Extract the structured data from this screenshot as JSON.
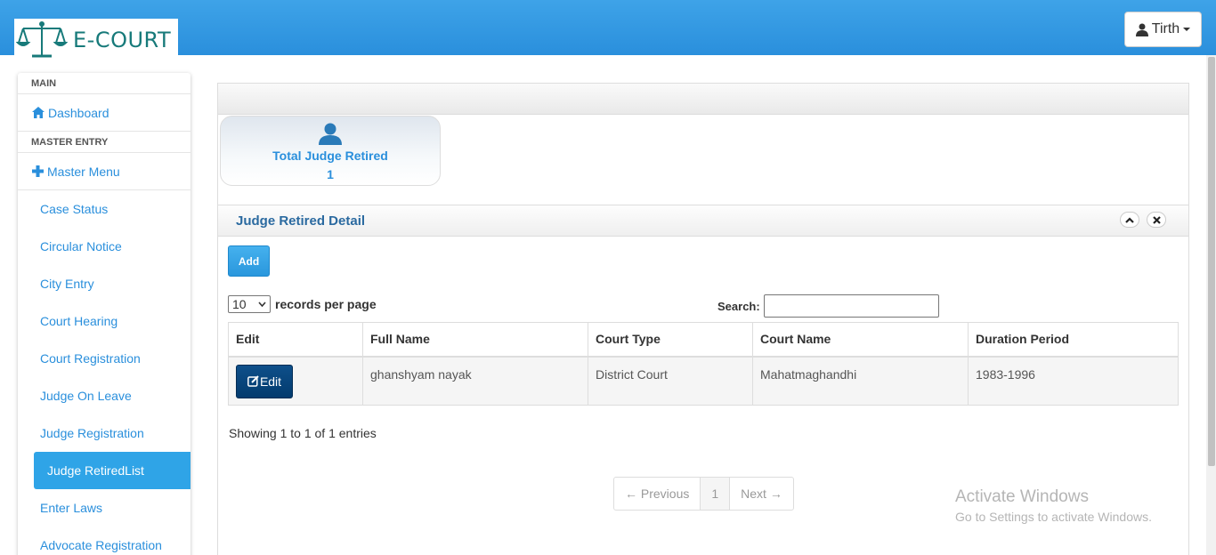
{
  "header": {
    "logo_text": "E-COURT",
    "user_name": "Tirth"
  },
  "sidebar": {
    "section_main": "MAIN",
    "dashboard": "Dashboard",
    "section_master": "MASTER ENTRY",
    "master_menu": "Master Menu",
    "items": [
      {
        "label": "Case Status",
        "active": false
      },
      {
        "label": "Circular Notice",
        "active": false
      },
      {
        "label": "City Entry",
        "active": false
      },
      {
        "label": "Court Hearing",
        "active": false
      },
      {
        "label": "Court Registration",
        "active": false
      },
      {
        "label": "Judge On Leave",
        "active": false
      },
      {
        "label": "Judge Registration",
        "active": false
      },
      {
        "label": "Judge RetiredList",
        "active": true
      },
      {
        "label": "Enter Laws",
        "active": false
      },
      {
        "label": "Advocate Registration",
        "active": false
      }
    ]
  },
  "stat": {
    "title": "Total Judge Retired",
    "value": "1"
  },
  "panel": {
    "title": "Judge Retired Detail",
    "add_label": "Add",
    "length_value": "10",
    "length_label": "records per page",
    "search_label": "Search:",
    "search_value": "",
    "columns": [
      "Edit",
      "Full Name",
      "Court Type",
      "Court Name",
      "Duration Period"
    ],
    "rows": [
      {
        "edit_label": "Edit",
        "full_name": "ghanshyam nayak",
        "court_type": "District Court",
        "court_name": "Mahatmaghandhi",
        "duration": "1983-1996"
      }
    ],
    "info": "Showing 1 to 1 of 1 entries",
    "pager": {
      "previous": "← Previous",
      "page": "1",
      "next": "Next →"
    }
  },
  "watermark": {
    "line1": "Activate Windows",
    "line2": "Go to Settings to activate Windows."
  },
  "colors": {
    "header_blue": "#2a8fdc",
    "link_blue": "#2a8fdc",
    "active_item": "#2fa4e7",
    "edit_button": "#033b6e"
  }
}
